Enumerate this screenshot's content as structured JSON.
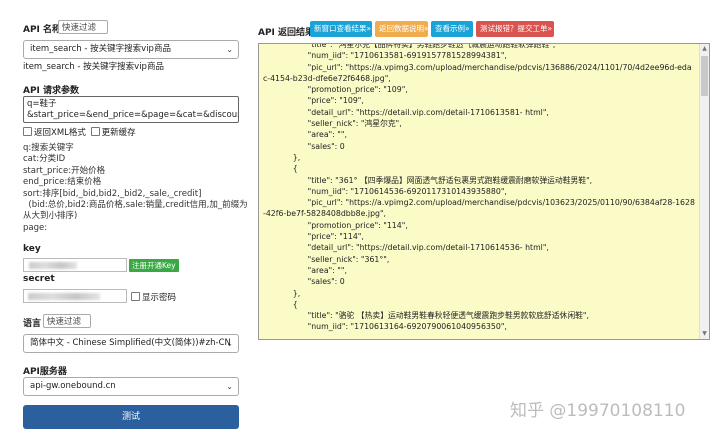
{
  "api_name": {
    "label": "API 名称",
    "filter_placeholder": "快速过滤",
    "selected": "item_search - 按关键字搜索vip商品",
    "description": "item_search - 按关键字搜索vip商品"
  },
  "params": {
    "label": "API 请求参数",
    "query_text": "q=鞋子\n&start_price=&end_price=&page=&cat=&discount_onl",
    "xml_label": "返回XML格式",
    "cache_label": "更新缓存",
    "docs": [
      "q:搜索关键字",
      "cat:分类ID",
      "start_price:开始价格",
      "end_price:结束价格",
      "sort:排序[bid,_bid,bid2,_bid2,_sale,_credit]",
      "  (bid:总价,bid2:商品价格,sale:销量,credit信用,加_前缀为",
      "从大到小排序)",
      "page:"
    ]
  },
  "key": {
    "label": "key",
    "register_label": "注册开通Key"
  },
  "secret": {
    "label": "secret",
    "show_label": "显示密码"
  },
  "language": {
    "label": "语言",
    "filter_placeholder": "快速过滤",
    "selected": "简体中文 - Chinese Simplified(中文(简体))#zh-CN"
  },
  "server": {
    "label": "API服务器",
    "selected": "api-gw.onebound.cn"
  },
  "submit_label": "测试",
  "result": {
    "label": "API 返回结果",
    "buttons": [
      {
        "label": "新窗口查看结果»",
        "color": "#1aa3d6"
      },
      {
        "label": "返回数据说明»",
        "color": "#f0ad4e"
      },
      {
        "label": "查看示例»",
        "color": "#1aa3d6"
      },
      {
        "label": "测试报错？提交工单»",
        "color": "#d9534f"
      }
    ],
    "json_text": "                  \"title\": \"鸿星尔克【品牌特卖】男鞋跑步鞋透气减震运动跑鞋软弹跑鞋\",\n                  \"num_iid\": \"1710613581-6919157781528994381\",\n                  \"pic_url\": \"https://a.vpimg3.com/upload/merchandise/pdcvis/136886/2024/1101/70/4d2ee96d-edac-4154-b23d-dfe6e72f6468.jpg\",\n                  \"promotion_price\": \"109\",\n                  \"price\": \"109\",\n                  \"detail_url\": \"https://detail.vip.com/detail-1710613581- html\",\n                  \"seller_nick\": \"鸿星尔克\",\n                  \"area\": \"\",\n                  \"sales\": 0\n            },\n            {\n                  \"title\": \"361° 【四季爆品】网面透气舒适包裹男式跑鞋缓震耐磨软弹运动鞋男鞋\",\n                  \"num_iid\": \"1710614536-6920117310143935880\",\n                  \"pic_url\": \"https://a.vpimg2.com/upload/merchandise/pdcvis/103623/2025/0110/90/6384af28-1628-42f6-be7f-5828408dbb8e.jpg\",\n                  \"promotion_price\": \"114\",\n                  \"price\": \"114\",\n                  \"detail_url\": \"https://detail.vip.com/detail-1710614536- html\",\n                  \"seller_nick\": \"361°\",\n                  \"area\": \"\",\n                  \"sales\": 0\n            },\n            {\n                  \"title\": \"骆驼 【热卖】运动鞋男鞋春秋轻便透气缓震跑步鞋男款软底舒适休闲鞋\",\n                  \"num_iid\": \"1710613164-6920790061040956350\","
  },
  "watermark": "知乎 @19970108110"
}
